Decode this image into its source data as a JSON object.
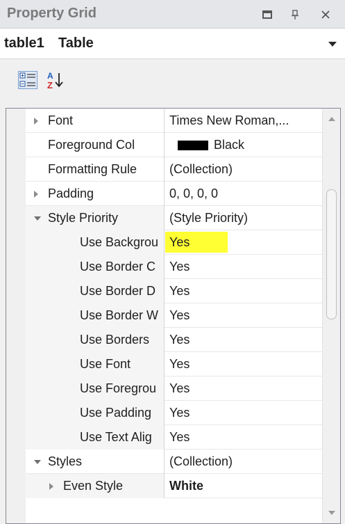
{
  "panel": {
    "title": "Property Grid",
    "buttons": [
      {
        "name": "maximize",
        "icon": "maximize-icon"
      },
      {
        "name": "pin",
        "icon": "pin-icon"
      },
      {
        "name": "close",
        "icon": "close-icon"
      }
    ]
  },
  "selector": {
    "name": "table1",
    "type": "Table",
    "icon": "dropdown-arrow-icon"
  },
  "toolbar": {
    "categorized_icon": "categorized-view-icon",
    "alphabetical_icon": "sort-alphabetical-icon"
  },
  "highlight_color": "#ffff33",
  "properties": [
    {
      "name": "Font",
      "value": "Times New Roman,...",
      "expander": "collapsed"
    },
    {
      "name": "Foreground Col",
      "value": "Black",
      "swatch": "#000000"
    },
    {
      "name": "Formatting Rule",
      "value": "(Collection)"
    },
    {
      "name": "Padding",
      "value": "0, 0, 0, 0",
      "expander": "collapsed"
    },
    {
      "name": "Style Priority",
      "value": "(Style Priority)",
      "expander": "expanded"
    },
    {
      "name": "Use Backgrou",
      "value": "Yes",
      "level": 1,
      "highlighted": true
    },
    {
      "name": "Use Border C",
      "value": "Yes",
      "level": 1
    },
    {
      "name": "Use Border D",
      "value": "Yes",
      "level": 1
    },
    {
      "name": "Use Border W",
      "value": "Yes",
      "level": 1
    },
    {
      "name": "Use Borders",
      "value": "Yes",
      "level": 1
    },
    {
      "name": "Use Font",
      "value": "Yes",
      "level": 1
    },
    {
      "name": "Use Foregrou",
      "value": "Yes",
      "level": 1
    },
    {
      "name": "Use Padding",
      "value": "Yes",
      "level": 1
    },
    {
      "name": "Use Text Alig",
      "value": "Yes",
      "level": 1
    },
    {
      "name": "Styles",
      "value": "(Collection)",
      "expander": "expanded"
    },
    {
      "name": "Even Style",
      "value": "White",
      "expander": "collapsed",
      "level": 1,
      "bold": true
    }
  ]
}
